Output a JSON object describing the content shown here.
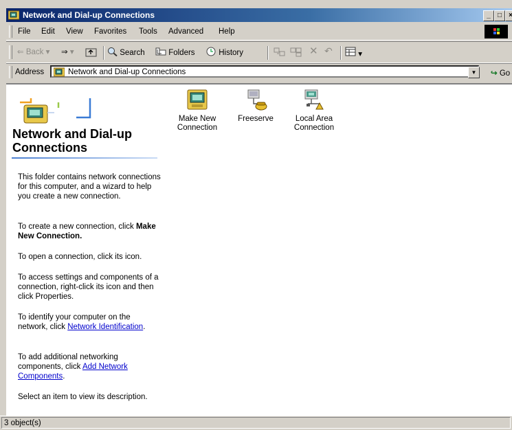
{
  "window": {
    "title": "Network and Dial-up Connections",
    "controls": [
      "_",
      "□",
      "×"
    ]
  },
  "menubar": {
    "items": [
      "File",
      "Edit",
      "View",
      "Favorites",
      "Tools",
      "Advanced",
      "Help"
    ]
  },
  "toolbar": {
    "back_label": "Back",
    "search_label": "Search",
    "folders_label": "Folders",
    "history_label": "History"
  },
  "address": {
    "label": "Address",
    "value": "Network and Dial-up Connections",
    "go_label": "Go"
  },
  "left_pane": {
    "heading": "Network and Dial-up Connections",
    "intro": "This folder contains network connections for this computer, and a wizard to help you create a new connection.",
    "create_prefix": "To create a new connection, click",
    "create_bold": "Make New Connection.",
    "open_text": "To open a connection, click its icon.",
    "settings_text": "To access settings and components of a connection, right-click its icon and then click Properties.",
    "identify_prefix": "To identify your computer on the network, click",
    "identify_link": "Network Identification",
    "identify_suffix": ".",
    "add_prefix": "To add additional networking components, click",
    "add_link": "Add Network Components",
    "add_suffix": ".",
    "select_text": "Select an item to view its description."
  },
  "items": [
    {
      "label_line1": "Make New",
      "label_line2": "Connection",
      "icon": "make-new-connection-icon"
    },
    {
      "label_line1": "Freeserve",
      "label_line2": "",
      "icon": "dialup-connection-icon"
    },
    {
      "label_line1": "Local Area",
      "label_line2": "Connection",
      "icon": "lan-connection-icon"
    }
  ],
  "statusbar": {
    "text": "3 object(s)"
  },
  "colors": {
    "titlebar_start": "#0a246a",
    "titlebar_end": "#a6caf0",
    "chrome": "#d4d0c8",
    "link": "#0000cc"
  }
}
